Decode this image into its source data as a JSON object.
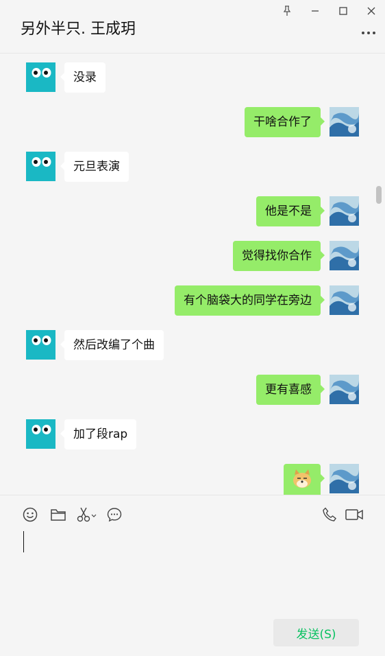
{
  "window": {
    "title": "另外半只. 王成玥"
  },
  "messages": [
    {
      "side": "left",
      "text": "没录"
    },
    {
      "side": "right",
      "text": "干啥合作了"
    },
    {
      "side": "left",
      "text": "元旦表演"
    },
    {
      "side": "right",
      "text": "他是不是"
    },
    {
      "side": "right",
      "text": "觉得找你合作"
    },
    {
      "side": "right",
      "text": "有个脑袋大的同学在旁边"
    },
    {
      "side": "left",
      "text": "然后改编了个曲"
    },
    {
      "side": "right",
      "text": "更有喜感"
    },
    {
      "side": "left",
      "text": "加了段rap"
    },
    {
      "side": "right",
      "text": ""
    }
  ],
  "composer": {
    "tools": [
      "emoji-icon",
      "folder-icon",
      "scissors-icon",
      "chat-history-icon",
      "phone-icon",
      "video-call-icon"
    ],
    "send_label": "发送(S)"
  },
  "colors": {
    "outgoing_bubble": "#95ec69",
    "incoming_bubble": "#ffffff",
    "contact_avatar": "#1ab8c4",
    "send_text": "#07c160",
    "background": "#f5f5f5"
  }
}
